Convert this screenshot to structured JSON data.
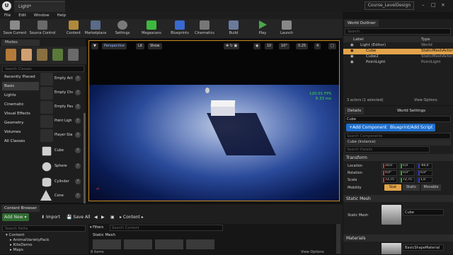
{
  "titlebar": {
    "tab": "Light*",
    "project": "Course_LevelDesign"
  },
  "menu": [
    "File",
    "Edit",
    "Window",
    "Help"
  ],
  "toolbar": [
    {
      "label": "Save Current",
      "color": "#8a8a8a"
    },
    {
      "label": "Source Control",
      "color": "#6a6a6a"
    },
    {
      "label": "Content",
      "color": "#b08a3a"
    },
    {
      "label": "Marketplace",
      "color": "#5a6a8a"
    },
    {
      "label": "Settings",
      "color": "#7a7a7a"
    },
    {
      "label": "Megascans",
      "color": "#3db83d"
    },
    {
      "label": "Blueprints",
      "color": "#3a6ad0"
    },
    {
      "label": "Cinematics",
      "color": "#777777"
    },
    {
      "label": "Build",
      "color": "#6a7a9a"
    },
    {
      "label": "Play",
      "color": "#4aa84a"
    },
    {
      "label": "Launch",
      "color": "#888888"
    }
  ],
  "modes": {
    "tab": "Modes",
    "search_placeholder": "Search Classes",
    "categories": [
      "Recently Placed",
      "Basic",
      "Lights",
      "Cinematic",
      "Visual Effects",
      "Geometry",
      "Volumes",
      "All Classes"
    ],
    "items": [
      "Empty Act",
      "Empty Cha",
      "Empty Pav",
      "Point Ligh",
      "Player Sta",
      "Cube",
      "Sphere",
      "Cylinder",
      "Cone"
    ]
  },
  "viewport": {
    "view_mode": "Perspective",
    "lit": "Lit",
    "show": "Show",
    "grid": "10",
    "rot": "10°",
    "scale": "0.25",
    "cam": "4",
    "fps": "120.01 FPS",
    "ms": "8.33 ms"
  },
  "outliner": {
    "tab": "World Outliner",
    "search_placeholder": "Search...",
    "col_label": "Label",
    "col_type": "Type",
    "rows": [
      {
        "label": "Light (Editor)",
        "type": "World"
      },
      {
        "label": "Cube",
        "type": "StaticMeshActor"
      },
      {
        "label": "Cube2",
        "type": "StaticMeshActor"
      },
      {
        "label": "PointLight",
        "type": "PointLight"
      }
    ],
    "footer": "3 actors (1 selected)",
    "view_options": "View Options"
  },
  "details": {
    "tab_details": "Details",
    "tab_world": "World Settings",
    "name": "Cube",
    "add_component": "+Add Component",
    "blueprint_script": "Blueprint/Add Script",
    "search_components": "Search Components",
    "instance": "Cube (Instance)",
    "search_details": "Search Details",
    "transform": "Transform",
    "location": {
      "label": "Location",
      "x": "10,0",
      "y": "0,0",
      "z": "-60,0"
    },
    "rotation": {
      "label": "Rotation",
      "x": "0,0°",
      "y": "0,0°",
      "z": "0,0°"
    },
    "scale": {
      "label": "Scale",
      "x": "72,75",
      "y": "72,75",
      "z": "1,0"
    },
    "mobility": {
      "label": "Mobility",
      "static": "Stat",
      "stationary": "Static",
      "movable": "Movable"
    },
    "static_mesh_section": "Static Mesh",
    "static_mesh_label": "Static Mesh",
    "static_mesh_value": "Cube",
    "materials_section": "Materials",
    "material_value": "BasicShapeMaterial"
  },
  "content_browser": {
    "tab": "Content Browser",
    "add_new": "Add New",
    "import": "Import",
    "save_all": "Save All",
    "path": "Content",
    "search_paths": "Search Paths",
    "filters": "Filters",
    "search_content": "Search Content",
    "tree": [
      "Content",
      "AnimalVarietyPack",
      "KiteDemo",
      "Maps"
    ],
    "item_label": "Static Mesh",
    "item_count": "8 items",
    "view_options": "View Options"
  }
}
